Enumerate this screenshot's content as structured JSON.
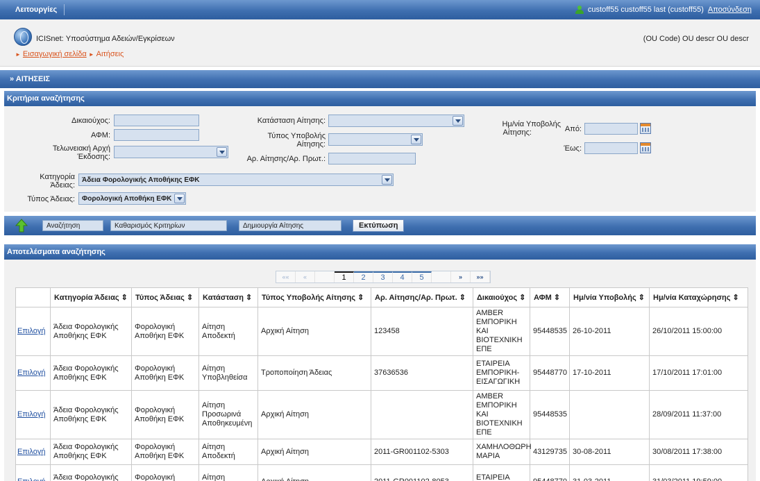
{
  "topbar": {
    "menu_label": "Λειτουργίες",
    "user_text": "custoff55 custoff55 last (custoff55)",
    "logout_label": "Αποσύνδεση"
  },
  "header": {
    "app_title": "ICISnet: Υποσύστημα Αδειών/Εγκρίσεων",
    "ou_text": "(OU Code) OU descr OU descr",
    "breadcrumb_home": "Εισαγωγική σελίδα",
    "breadcrumb_current": "Αιτήσεις"
  },
  "sections": {
    "aitiseis": "» ΑΙΤΗΣΕΙΣ",
    "criteria": "Κριτήρια αναζήτησης",
    "results": "Αποτελέσματα αναζήτησης"
  },
  "criteria": {
    "beneficiary_label": "Δικαιούχος:",
    "beneficiary_value": "",
    "afm_label": "ΑΦΜ:",
    "afm_value": "",
    "customs_office_label_1": "Τελωνειακή Αρχή",
    "customs_office_label_2": "Έκδοσης:",
    "customs_office_value": "",
    "status_label": "Κατάσταση Αίτησης:",
    "status_value": "",
    "submission_type_label_1": "Τύπος Υποβολής",
    "submission_type_label_2": "Αίτησης:",
    "submission_type_value": "",
    "app_number_label": "Αρ. Αίτησης/Αρ. Πρωτ.:",
    "app_number_value": "",
    "date_label_1": "Ημ/νία Υποβολής",
    "date_label_2": "Αίτησης:",
    "from_label": "Από:",
    "to_label": "Έως:",
    "from_value": "",
    "to_value": "",
    "category_label_1": "Κατηγορία",
    "category_label_2": "Άδειας:",
    "category_value": "Άδεια Φορολογικής Αποθήκης ΕΦΚ",
    "license_type_label": "Τύπος Άδειας:",
    "license_type_value": "Φορολογική Αποθήκη ΕΦΚ"
  },
  "actions": {
    "search": "Αναζήτηση",
    "clear": "Καθαρισμός Κριτηρίων",
    "create": "Δημιουργία Αίτησης",
    "print": "Εκτύπωση"
  },
  "pager": {
    "first": "««",
    "prev": "«",
    "pages": [
      "1",
      "2",
      "3",
      "4",
      "5"
    ],
    "current": "1",
    "next": "»",
    "last": "»»"
  },
  "table": {
    "columns": [
      "",
      "Κατηγορία Άδειας ⇕",
      "Τύπος Άδειας ⇕",
      "Κατάσταση ⇕",
      "Τύπος Υποβολής Αίτησης ⇕",
      "Αρ. Αίτησης/Αρ. Πρωτ. ⇕",
      "Δικαιούχος ⇕",
      "ΑΦΜ ⇕",
      "Ημ/νία Υποβολής ⇕",
      "Ημ/νία Καταχώρησης ⇕"
    ],
    "select_label": "Επιλογή",
    "rows": [
      [
        "Άδεια Φορολογικής Αποθήκης ΕΦΚ",
        "Φορολογική Αποθήκη ΕΦΚ",
        "Αίτηση Αποδεκτή",
        "Αρχική Αίτηση",
        "123458",
        "AMBER ΕΜΠΟΡΙΚΗ ΚΑΙ ΒΙΟΤΕΧΝΙΚΗ ΕΠΕ",
        "95448535",
        "26-10-2011",
        "26/10/2011 15:00:00"
      ],
      [
        "Άδεια Φορολογικής Αποθήκης ΕΦΚ",
        "Φορολογική Αποθήκη ΕΦΚ",
        "Αίτηση Υποβληθείσα",
        "Τροποποίηση Άδειας",
        "37636536",
        "ΕΤΑΙΡΕΙΑ ΕΜΠΟΡΙΚΗ-ΕΙΣΑΓΩΓΙΚΗ",
        "95448770",
        "17-10-2011",
        "17/10/2011 17:01:00"
      ],
      [
        "Άδεια Φορολογικής Αποθήκης ΕΦΚ",
        "Φορολογική Αποθήκη ΕΦΚ",
        "Αίτηση Προσωρινά Αποθηκευμένη",
        "Αρχική Αίτηση",
        "",
        "AMBER ΕΜΠΟΡΙΚΗ ΚΑΙ ΒΙΟΤΕΧΝΙΚΗ ΕΠΕ",
        "95448535",
        "",
        "28/09/2011 11:37:00"
      ],
      [
        "Άδεια Φορολογικής Αποθήκης ΕΦΚ",
        "Φορολογική Αποθήκη ΕΦΚ",
        "Αίτηση Αποδεκτή",
        "Αρχική Αίτηση",
        "2011-GR001102-5303",
        "ΧΑΜΗΛΟΘΩΡΗ ΜΑΡΙΑ",
        "43129735",
        "30-08-2011",
        "30/08/2011 17:38:00"
      ],
      [
        "Άδεια Φορολογικής Αποθήκης ΕΦΚ",
        "Φορολογική Αποθήκη ΕΦΚ",
        "Αίτηση Αποδεκτή",
        "Αρχική Αίτηση",
        "2011-GR001102-8053",
        "ΕΤΑΙΡΕΙΑ ΕΜΠΟΡΙΚΗ-",
        "95448770",
        "31-03-2011",
        "31/03/2011 19:59:00"
      ]
    ]
  }
}
